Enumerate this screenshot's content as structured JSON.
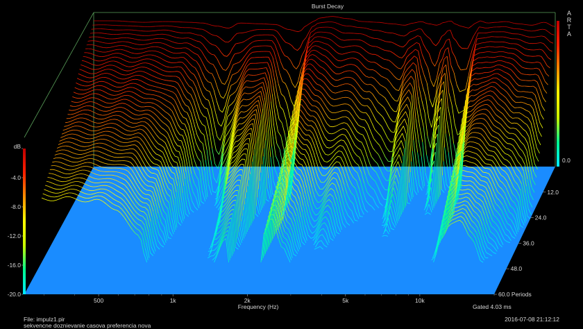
{
  "chart_data": {
    "type": "waterfall",
    "title": "Burst Decay",
    "brand": "ARTA",
    "xlabel": "Frequency (Hz)",
    "x_scale": "log",
    "xlim": [
      250,
      20000
    ],
    "x_ticks": [
      500,
      1000,
      2000,
      5000,
      10000
    ],
    "x_tick_labels": [
      "500",
      "1k",
      "2k",
      "5k",
      "10k"
    ],
    "z_label": "dB",
    "z_ticks": [
      0.0,
      -4.0,
      -8.0,
      -12.0,
      -16.0,
      -20.0
    ],
    "z_tick_labels": [
      "dB",
      "-4.0",
      "-8.0",
      "-12.0",
      "-16.0",
      "-20.0"
    ],
    "right_level_label": "0.0",
    "zlim": [
      -20,
      0
    ],
    "t_label": "Periods",
    "t_ticks": [
      12.0,
      24.0,
      36.0,
      48.0,
      60.0
    ],
    "t_tick_labels": [
      "12.0",
      "24.0",
      "36.0",
      "48.0",
      "60.0 Periods"
    ],
    "tlim": [
      0,
      60
    ],
    "gated": "Gated 4.03 ms",
    "colormap": [
      "#00e8ff",
      "#00ff90",
      "#c8ff00",
      "#ffff00",
      "#ff9000",
      "#ff2000",
      "#c00000"
    ],
    "floor_color": "#1a8cff",
    "decay_profile": {
      "frequency_hz": [
        250,
        300,
        400,
        500,
        620,
        700,
        800,
        900,
        1000,
        1200,
        1400,
        1600,
        1750,
        1900,
        2000,
        2150,
        2400,
        2800,
        3200,
        3700,
        4200,
        4800,
        5200,
        5600,
        6000,
        6500,
        7000,
        7400,
        7800,
        8300,
        8800,
        9300,
        9800,
        10500,
        11500,
        12500,
        14000,
        16000,
        18000,
        20000
      ],
      "initial_level_db": [
        0.0,
        0.0,
        -0.2,
        -0.1,
        -0.2,
        -0.3,
        -0.7,
        -1.0,
        -0.3,
        -0.4,
        -0.5,
        -1.2,
        -1.5,
        -0.6,
        -0.1,
        0.4,
        0.6,
        0.3,
        -0.1,
        -0.2,
        -0.4,
        -0.6,
        -0.3,
        -0.1,
        -0.4,
        -0.6,
        -0.2,
        0.0,
        -0.5,
        -0.8,
        -1.0,
        -0.4,
        0.0,
        -0.3,
        -0.2,
        -0.1,
        -0.4,
        -0.6,
        -0.2,
        -0.8
      ],
      "decay_rate_db_per_period": [
        0.22,
        0.22,
        0.22,
        0.25,
        0.35,
        0.5,
        0.9,
        1.6,
        1.0,
        0.45,
        0.35,
        1.5,
        2.2,
        1.3,
        0.35,
        0.3,
        0.4,
        0.6,
        0.5,
        0.7,
        0.9,
        1.1,
        0.7,
        0.6,
        1.4,
        2.4,
        1.3,
        0.8,
        1.8,
        2.6,
        2.4,
        1.3,
        0.45,
        0.35,
        0.3,
        0.3,
        0.35,
        0.45,
        0.55,
        0.8
      ]
    }
  },
  "footer": {
    "file": "File: impulz1.pir",
    "description": "sekvencne doznievanie casova preferencia nova",
    "datetime": "2016-07-08  21:12:12"
  }
}
